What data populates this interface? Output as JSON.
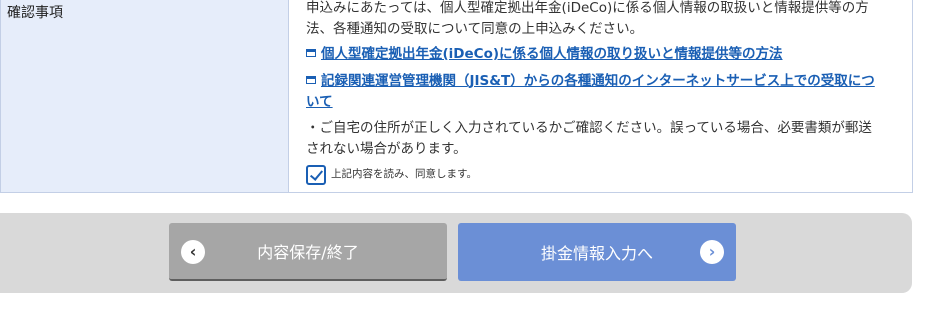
{
  "confirmation": {
    "label": "確認事項",
    "intro_line1": "申込みにあたっては、個人型確定拠出年金(iDeCo)に係る個人情報の取扱いと情報提供等の方",
    "intro_line2": "法、各種通知の受取について同意の上申込みください。",
    "link1": "個人型確定拠出年金(iDeCo)に係る個人情報の取り扱いと情報提供等の方法",
    "link2_line1": "記録関連運営管理機関（JIS&T）からの各種通知のインターネットサービス上での受取につ",
    "link2_line2": "いて",
    "note_line1": "・ご自宅の住所が正しく入力されているかご確認ください。誤っている場合、必要書類が郵送",
    "note_line2": "されない場合があります。",
    "agree_label": "上記内容を読み、同意します。",
    "agree_checked": true
  },
  "buttons": {
    "back_label": "内容保存/終了",
    "back_icon": "‹",
    "next_label": "掛金情報入力へ",
    "next_icon": "›"
  },
  "colors": {
    "link": "#1a5fb4",
    "label_bg": "#e6edfa",
    "back_button": "#a6a6a6",
    "next_button": "#6b8fd6",
    "button_bar": "#d9d9d9"
  }
}
